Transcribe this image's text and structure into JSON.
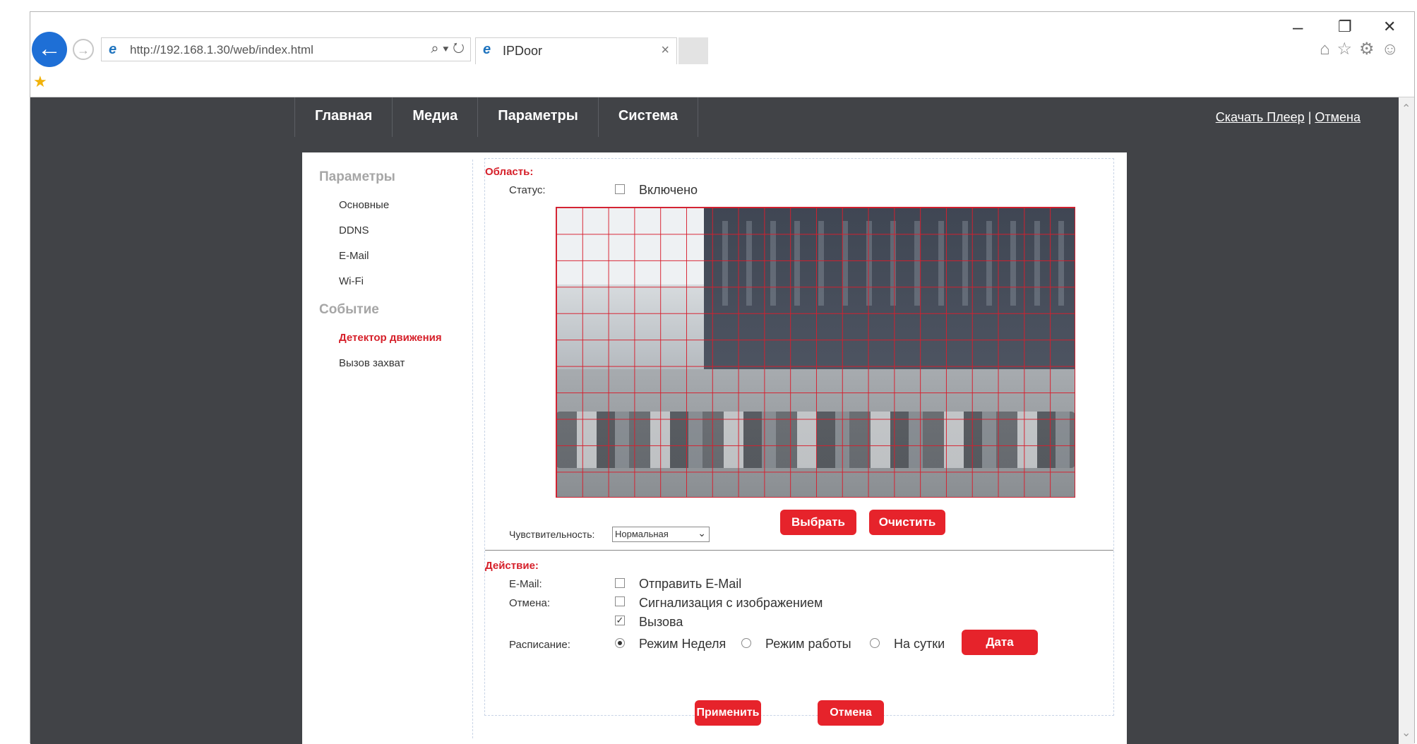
{
  "browser": {
    "url": "http://192.168.1.30/web/index.html",
    "tab_title": "IPDoor",
    "tab_close": "×",
    "minimize": "–",
    "restore": "❐",
    "close": "✕",
    "search_tools": "⌕ ▾ ↻",
    "right_icons": "⌂☆⚙☺"
  },
  "nav": {
    "items": [
      "Главная",
      "Медиа",
      "Параметры",
      "Система"
    ],
    "download_link": "Скачать Плеер",
    "separator": "|",
    "cancel_link": "Отмена"
  },
  "sidebar": {
    "params_heading": "Параметры",
    "params_items": [
      "Основные",
      "DDNS",
      "E-Mail",
      "Wi-Fi"
    ],
    "event_heading": "Событие",
    "event_items": [
      "Детектор движения",
      "Вызов захват"
    ]
  },
  "area": {
    "section_label": "Область:",
    "status_label": "Статус:",
    "status_option": "Включено",
    "status_checked": false,
    "sensitivity_label": "Чувствительность:",
    "sensitivity_value": "Нормальная",
    "select_button": "Выбрать",
    "clear_button": "Очистить",
    "grid_columns": 20,
    "grid_rows": 11
  },
  "action": {
    "section_label": "Действие:",
    "email_label": "E-Mail:",
    "email_option": "Отправить E-Mail",
    "email_checked": false,
    "cancel_label": "Отмена:",
    "alarm_option": "Сигнализация с изображением",
    "alarm_checked": false,
    "call_option": "Вызова",
    "call_checked": true,
    "schedule_label": "Расписание:",
    "schedule_options": [
      "Режим Неделя",
      "Режим работы",
      "На сутки"
    ],
    "schedule_selected": "Режим Неделя",
    "date_button": "Дата"
  },
  "footer": {
    "apply_button": "Применить",
    "cancel_button": "Отмена"
  },
  "colors": {
    "accent": "#e6232b",
    "nav_bg": "#414347",
    "sidebar_heading": "#a6a6a6"
  }
}
